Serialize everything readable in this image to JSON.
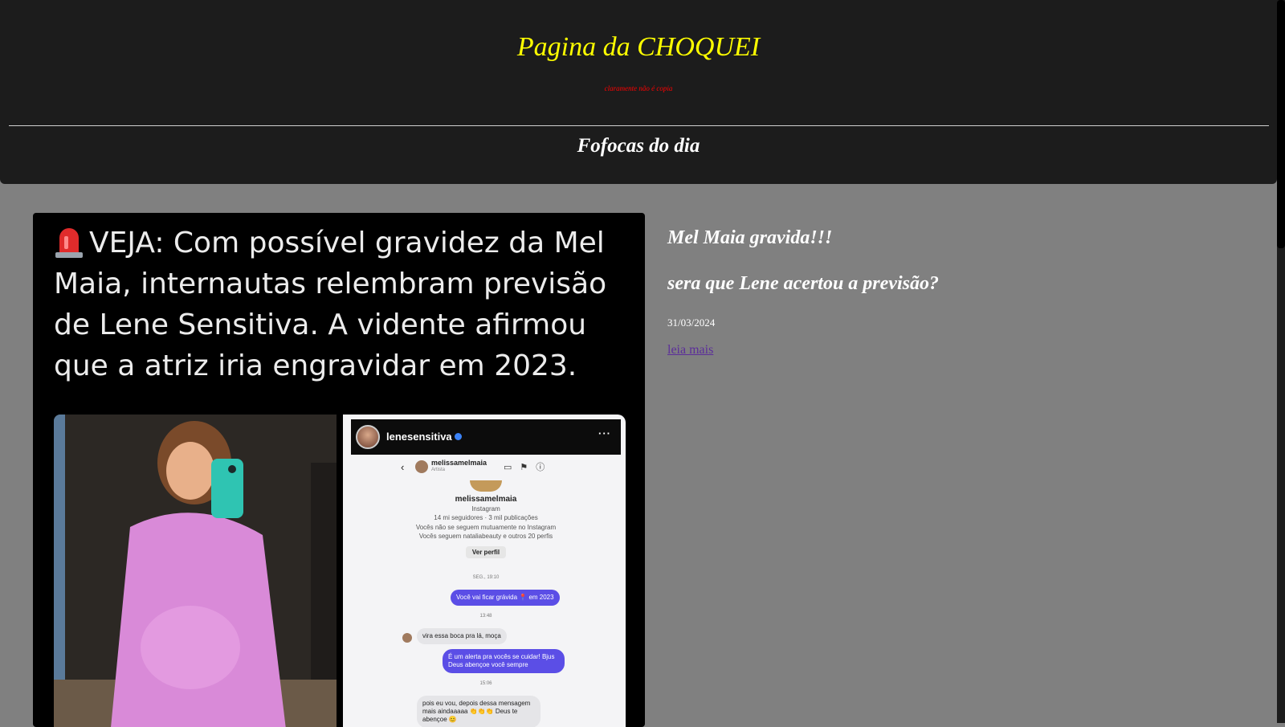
{
  "header": {
    "site_title": "Pagina da CHOQUEI",
    "tagline": "claramente não é copia",
    "section_title": "Fofocas do dia"
  },
  "post": {
    "image": {
      "headline": "VEJA: Com possível gravidez da Mel Maia, internautas relembram previsão de Lene Sensitiva. A vidente afirmou que a atriz iria engravidar em 2023.",
      "screenshot": {
        "account": "lenesensitiva",
        "more": "···",
        "dm_user": "melissamelmaia",
        "dm_sub": "Artista",
        "profile_name": "melissamelmaia",
        "profile_source": "Instagram",
        "profile_stats": "14 mi seguidores · 3 mil publicações",
        "profile_mutual": "Vocês não se seguem mutuamente no Instagram",
        "profile_follows": "Vocês seguem nataliabeauty e outros 20 perfis",
        "profile_button": "Ver perfil",
        "time_1": "SEG., 19:10",
        "msg_1": "Você vai ficar grávida 📍 em 2023",
        "time_2": "13:48",
        "msg_2": "vira essa boca pra lá, moça",
        "msg_3": "É um alerta pra vocês se cuidar! Bjus Deus abençoe você sempre",
        "time_3": "15:06",
        "msg_4": "pois eu vou, depois dessa mensagem mais aindaaaaa 👏👏👏 Deus te abençoe 😊"
      }
    },
    "title": "Mel Maia gravida!!!",
    "subtitle": "sera que Lene acertou a previsão?",
    "date": "31/03/2024",
    "read_more": "leia mais"
  },
  "colors": {
    "page_bg": "#808080",
    "header_bg": "#1c1c1c",
    "title": "#ffff00",
    "tagline": "#ff0000",
    "link": "#5b2d9a"
  }
}
